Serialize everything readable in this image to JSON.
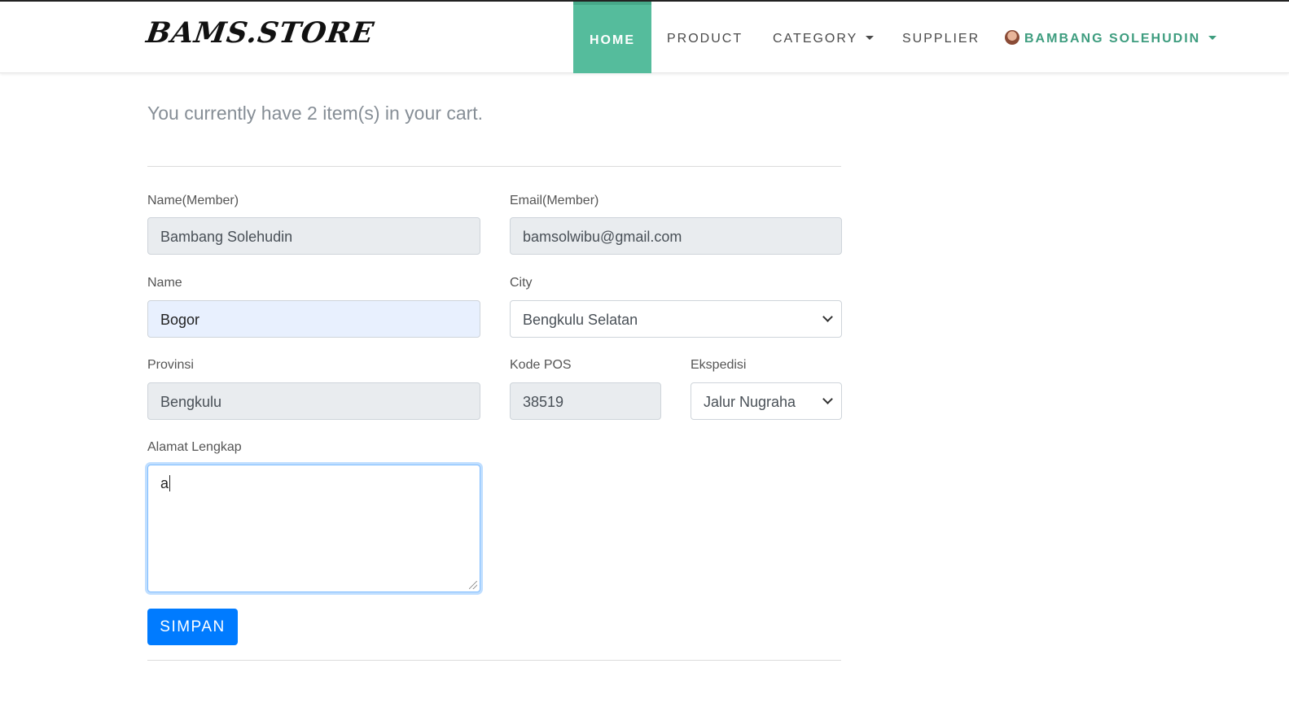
{
  "navbar": {
    "brand": "BAMS.STORE",
    "items": [
      {
        "label": "HOME",
        "active": true
      },
      {
        "label": "PRODUCT"
      },
      {
        "label": "CATEGORY",
        "dropdown": true
      },
      {
        "label": "SUPPLIER"
      }
    ],
    "user": {
      "name": "BAMBANG SOLEHUDIN",
      "icon": "avatar"
    }
  },
  "cart": {
    "message": "You currently have 2 item(s) in your cart."
  },
  "form": {
    "name_member": {
      "label": "Name(Member)",
      "value": "Bambang Solehudin",
      "readonly": true
    },
    "email_member": {
      "label": "Email(Member)",
      "value": "bamsolwibu@gmail.com",
      "readonly": true
    },
    "name": {
      "label": "Name",
      "value": "Bogor"
    },
    "city": {
      "label": "City",
      "value": "Bengkulu Selatan"
    },
    "provinsi": {
      "label": "Provinsi",
      "value": "Bengkulu",
      "readonly": true
    },
    "kode_pos": {
      "label": "Kode POS",
      "value": "38519",
      "readonly": true
    },
    "ekspedisi": {
      "label": "Ekspedisi",
      "value": "Jalur Nugraha"
    },
    "alamat": {
      "label": "Alamat Lengkap",
      "value": "a"
    },
    "submit_label": "SIMPAN"
  },
  "colors": {
    "accent_nav": "#55bc9c",
    "user_text": "#3e9d7f",
    "primary_button": "#007bff"
  }
}
